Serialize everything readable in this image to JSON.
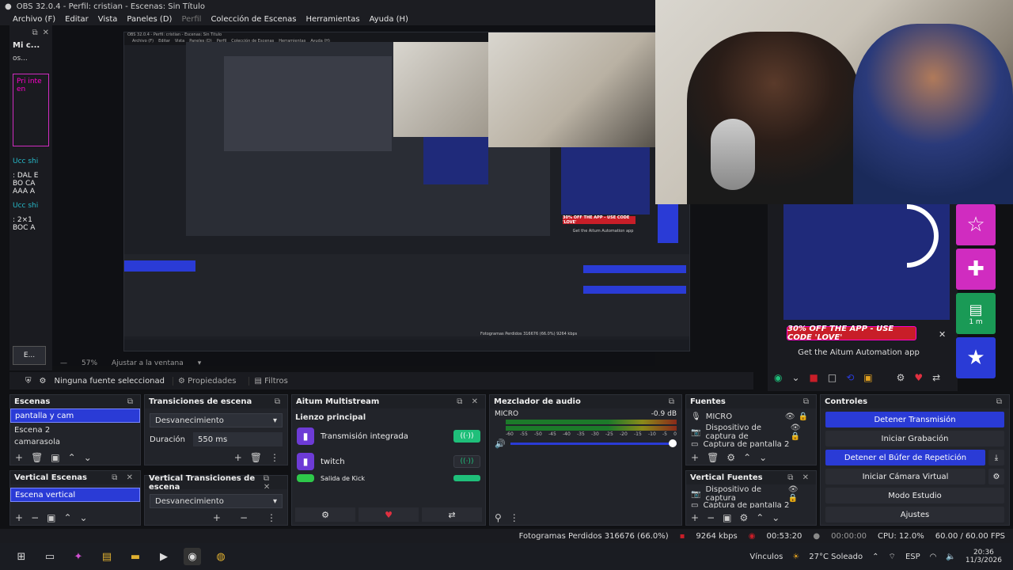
{
  "window": {
    "title": "OBS 32.0.4 - Perfil: cristian - Escenas: Sin Título"
  },
  "menu": [
    "Archivo (F)",
    "Editar",
    "Vista",
    "Paneles (D)",
    "Perfil",
    "Colección de Escenas",
    "Herramientas",
    "Ayuda (H)"
  ],
  "left_strip": {
    "header": "Mi c...",
    "items": [
      "os...",
      "Pri inte en",
      "Ucc shi",
      ": DAL E BO CA AAA A",
      "Ucc shi",
      ": 2×1 BOC A"
    ],
    "bottom": "E..."
  },
  "nested_preview": {
    "title": "OBS 32.0.4 - Perfil: cristian - Escenas: Sin Título",
    "menu": [
      "Archivo (F)",
      "Editar",
      "Vista",
      "Paneles (D)",
      "Perfil",
      "Colección de Escenas",
      "Herramientas",
      "Ayuda (H)"
    ],
    "promo": "30% OFF THE APP - USE CODE 'LOVE'",
    "getapp": "Get the Aitum Automation app",
    "statusbar": "Fotogramas Perdidos 316676 (66.0%)   9264 kbps"
  },
  "preview_status": {
    "zoom": "57%",
    "fit": "Ajustar a la ventana"
  },
  "overlay": {
    "promo": "30% OFF THE APP - USE CODE 'LOVE'",
    "getapp": "Get the Aitum Automation app",
    "widget_label": "1 m"
  },
  "source_bar": {
    "none_selected": "Ninguna fuente seleccionad",
    "properties": "Propiedades",
    "filters": "Filtros"
  },
  "docks": {
    "scenes": {
      "title": "Escenas",
      "items": [
        "pantalla y cam",
        "Escena 2",
        "camarasola"
      ]
    },
    "vertical_scenes": {
      "title": "Vertical Escenas",
      "items": [
        "Escena vertical"
      ]
    },
    "transitions": {
      "title": "Transiciones de escena",
      "select": "Desvanecimiento",
      "duration_label": "Duración",
      "duration_value": "550 ms"
    },
    "vertical_transitions": {
      "title": "Vertical Transiciones de escena",
      "select": "Desvanecimiento"
    },
    "multistream": {
      "title": "Aitum Multistream",
      "section": "Lienzo principal",
      "rows": [
        {
          "name": "Transmisión integrada",
          "state": "on"
        },
        {
          "name": "twitch",
          "state": "off"
        },
        {
          "name": "Salida de Kick",
          "state": "on"
        }
      ]
    },
    "mixer": {
      "title": "Mezclador de audio",
      "channel": "MICRO",
      "db": "-0.9 dB",
      "scale": [
        "-60",
        "-55",
        "-50",
        "-45",
        "-40",
        "-35",
        "-30",
        "-25",
        "-20",
        "-15",
        "-10",
        "-5",
        "0"
      ]
    },
    "sources": {
      "title": "Fuentes",
      "items": [
        "MICRO",
        "Dispositivo de captura de",
        "Captura de pantalla 2"
      ]
    },
    "vertical_sources": {
      "title": "Vertical Fuentes",
      "items": [
        "Dispositivo de captura",
        "Captura de pantalla 2"
      ]
    },
    "controls": {
      "title": "Controles",
      "buttons": [
        {
          "label": "Detener Transmisión",
          "active": true
        },
        {
          "label": "Iniciar Grabación",
          "active": false
        },
        {
          "label": "Detener el Búfer de Repetición",
          "active": true
        },
        {
          "label": "Iniciar Cámara Virtual",
          "active": false
        },
        {
          "label": "Modo Estudio",
          "active": false
        },
        {
          "label": "Ajustes",
          "active": false
        }
      ]
    }
  },
  "status": {
    "dropped": "Fotogramas Perdidos 316676 (66.0%)",
    "kbps": "9264 kbps",
    "stream_time": "00:53:20",
    "rec_time": "00:00:00",
    "cpu": "CPU: 12.0%",
    "fps": "60.00 / 60.00 FPS"
  },
  "taskbar": {
    "vinculos": "Vínculos",
    "weather": "27°C  Soleado",
    "lang": "ESP",
    "time": "20:36",
    "date": "11/3/2026"
  },
  "colors": {
    "accent": "#2a3bd6",
    "twitch": "#6d3bd6",
    "live_green": "#1fbf7a",
    "promo_red": "#c81e28",
    "overlay_pink": "#d02cc0"
  }
}
